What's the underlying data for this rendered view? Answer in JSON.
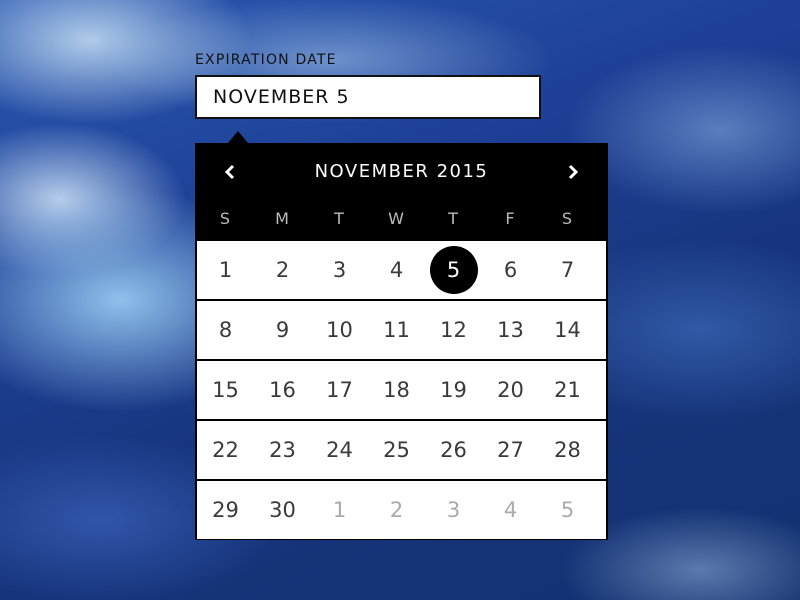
{
  "field": {
    "label": "EXPIRATION DATE",
    "value": "NOVEMBER 5",
    "placeholder": ""
  },
  "calendar": {
    "title": "NOVEMBER 2015",
    "prev_icon": "chevron-left-icon",
    "next_icon": "chevron-right-icon",
    "weekdays": [
      "S",
      "M",
      "T",
      "W",
      "T",
      "F",
      "S"
    ],
    "selected_day": "5",
    "weeks": [
      [
        {
          "label": "1",
          "muted": false
        },
        {
          "label": "2",
          "muted": false
        },
        {
          "label": "3",
          "muted": false
        },
        {
          "label": "4",
          "muted": false
        },
        {
          "label": "5",
          "muted": false,
          "selected": true
        },
        {
          "label": "6",
          "muted": false
        },
        {
          "label": "7",
          "muted": false
        }
      ],
      [
        {
          "label": "8",
          "muted": false
        },
        {
          "label": "9",
          "muted": false
        },
        {
          "label": "10",
          "muted": false
        },
        {
          "label": "11",
          "muted": false
        },
        {
          "label": "12",
          "muted": false
        },
        {
          "label": "13",
          "muted": false
        },
        {
          "label": "14",
          "muted": false
        }
      ],
      [
        {
          "label": "15",
          "muted": false
        },
        {
          "label": "16",
          "muted": false
        },
        {
          "label": "17",
          "muted": false
        },
        {
          "label": "18",
          "muted": false
        },
        {
          "label": "19",
          "muted": false
        },
        {
          "label": "20",
          "muted": false
        },
        {
          "label": "21",
          "muted": false
        }
      ],
      [
        {
          "label": "22",
          "muted": false
        },
        {
          "label": "23",
          "muted": false
        },
        {
          "label": "24",
          "muted": false
        },
        {
          "label": "25",
          "muted": false
        },
        {
          "label": "26",
          "muted": false
        },
        {
          "label": "27",
          "muted": false
        },
        {
          "label": "28",
          "muted": false
        }
      ],
      [
        {
          "label": "29",
          "muted": false
        },
        {
          "label": "30",
          "muted": false
        },
        {
          "label": "1",
          "muted": true
        },
        {
          "label": "2",
          "muted": true
        },
        {
          "label": "3",
          "muted": true
        },
        {
          "label": "4",
          "muted": true
        },
        {
          "label": "5",
          "muted": true
        }
      ]
    ]
  },
  "colors": {
    "header_bg": "#000000",
    "day_text": "#3a3a3a",
    "muted_text": "#aaaaaa",
    "selected_bg": "#000000",
    "selected_text": "#ffffff"
  }
}
